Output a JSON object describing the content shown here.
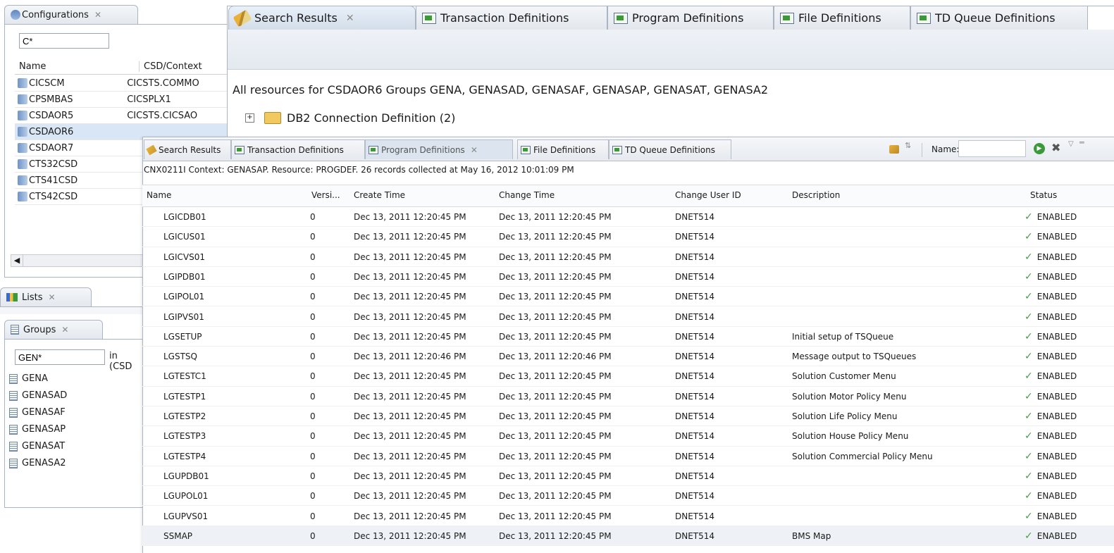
{
  "configurations": {
    "title": "Configurations",
    "filter": "C*",
    "columns": [
      "Name",
      "CSD/Context"
    ],
    "rows": [
      {
        "name": "CICSCM",
        "context": "CICSTS.COMMO"
      },
      {
        "name": "CPSMBAS",
        "context": "CICSPLX1"
      },
      {
        "name": "CSDAOR5",
        "context": "CICSTS.CICSAO"
      },
      {
        "name": "CSDAOR6",
        "context": ""
      },
      {
        "name": "CSDAOR7",
        "context": ""
      },
      {
        "name": "CTS32CSD",
        "context": ""
      },
      {
        "name": "CTS41CSD",
        "context": ""
      },
      {
        "name": "CTS42CSD",
        "context": ""
      }
    ]
  },
  "lists": {
    "title": "Lists"
  },
  "groups": {
    "title": "Groups",
    "filter": "GEN*",
    "in_label": "in (CSD",
    "items": [
      "GENA",
      "GENASAD",
      "GENASAF",
      "GENASAP",
      "GENASAT",
      "GENASA2"
    ]
  },
  "editor": {
    "tabs": [
      {
        "label": "Search Results"
      },
      {
        "label": "Transaction Definitions"
      },
      {
        "label": "Program Definitions"
      },
      {
        "label": "File Definitions"
      },
      {
        "label": "TD Queue Definitions"
      }
    ],
    "heading": "All resources for CSDAOR6 Groups GENA, GENASAD, GENASAF, GENASAP, GENASAT, GENASA2",
    "tree_item": "DB2 Connection Definition (2)"
  },
  "panel": {
    "tabs": [
      {
        "label": "Search Results"
      },
      {
        "label": "Transaction Definitions"
      },
      {
        "label": "Program Definitions"
      },
      {
        "label": "File Definitions"
      },
      {
        "label": "TD Queue Definitions"
      }
    ],
    "name_label": "Name:",
    "status_line": "CNX0211I Context: GENASAP. Resource: PROGDEF. 26 records collected at May 16, 2012 10:01:09 PM",
    "columns": [
      "Name",
      "Versi...",
      "Create Time",
      "Change Time",
      "Change User ID",
      "Description",
      "Status"
    ],
    "rows": [
      {
        "name": "LGICDB01",
        "ver": "0",
        "create": "Dec 13, 2011 12:20:45 PM",
        "change": "Dec 13, 2011 12:20:45 PM",
        "user": "DNET514",
        "desc": "",
        "status": "ENABLED"
      },
      {
        "name": "LGICUS01",
        "ver": "0",
        "create": "Dec 13, 2011 12:20:45 PM",
        "change": "Dec 13, 2011 12:20:45 PM",
        "user": "DNET514",
        "desc": "",
        "status": "ENABLED"
      },
      {
        "name": "LGICVS01",
        "ver": "0",
        "create": "Dec 13, 2011 12:20:45 PM",
        "change": "Dec 13, 2011 12:20:45 PM",
        "user": "DNET514",
        "desc": "",
        "status": "ENABLED"
      },
      {
        "name": "LGIPDB01",
        "ver": "0",
        "create": "Dec 13, 2011 12:20:45 PM",
        "change": "Dec 13, 2011 12:20:45 PM",
        "user": "DNET514",
        "desc": "",
        "status": "ENABLED"
      },
      {
        "name": "LGIPOL01",
        "ver": "0",
        "create": "Dec 13, 2011 12:20:45 PM",
        "change": "Dec 13, 2011 12:20:45 PM",
        "user": "DNET514",
        "desc": "",
        "status": "ENABLED"
      },
      {
        "name": "LGIPVS01",
        "ver": "0",
        "create": "Dec 13, 2011 12:20:45 PM",
        "change": "Dec 13, 2011 12:20:45 PM",
        "user": "DNET514",
        "desc": "",
        "status": "ENABLED"
      },
      {
        "name": "LGSETUP",
        "ver": "0",
        "create": "Dec 13, 2011 12:20:45 PM",
        "change": "Dec 13, 2011 12:20:45 PM",
        "user": "DNET514",
        "desc": "Initial setup of TSQueue",
        "status": "ENABLED"
      },
      {
        "name": "LGSTSQ",
        "ver": "0",
        "create": "Dec 13, 2011 12:20:46 PM",
        "change": "Dec 13, 2011 12:20:46 PM",
        "user": "DNET514",
        "desc": "Message output to TSQueues",
        "status": "ENABLED"
      },
      {
        "name": "LGTESTC1",
        "ver": "0",
        "create": "Dec 13, 2011 12:20:45 PM",
        "change": "Dec 13, 2011 12:20:45 PM",
        "user": "DNET514",
        "desc": "Solution Customer Menu",
        "status": "ENABLED"
      },
      {
        "name": "LGTESTP1",
        "ver": "0",
        "create": "Dec 13, 2011 12:20:45 PM",
        "change": "Dec 13, 2011 12:20:45 PM",
        "user": "DNET514",
        "desc": "Solution Motor Policy Menu",
        "status": "ENABLED"
      },
      {
        "name": "LGTESTP2",
        "ver": "0",
        "create": "Dec 13, 2011 12:20:45 PM",
        "change": "Dec 13, 2011 12:20:45 PM",
        "user": "DNET514",
        "desc": "Solution Life Policy Menu",
        "status": "ENABLED"
      },
      {
        "name": "LGTESTP3",
        "ver": "0",
        "create": "Dec 13, 2011 12:20:45 PM",
        "change": "Dec 13, 2011 12:20:45 PM",
        "user": "DNET514",
        "desc": "Solution House Policy Menu",
        "status": "ENABLED"
      },
      {
        "name": "LGTESTP4",
        "ver": "0",
        "create": "Dec 13, 2011 12:20:45 PM",
        "change": "Dec 13, 2011 12:20:45 PM",
        "user": "DNET514",
        "desc": "Solution Commercial Policy Menu",
        "status": "ENABLED"
      },
      {
        "name": "LGUPDB01",
        "ver": "0",
        "create": "Dec 13, 2011 12:20:45 PM",
        "change": "Dec 13, 2011 12:20:45 PM",
        "user": "DNET514",
        "desc": "",
        "status": "ENABLED"
      },
      {
        "name": "LGUPOL01",
        "ver": "0",
        "create": "Dec 13, 2011 12:20:45 PM",
        "change": "Dec 13, 2011 12:20:45 PM",
        "user": "DNET514",
        "desc": "",
        "status": "ENABLED"
      },
      {
        "name": "LGUPVS01",
        "ver": "0",
        "create": "Dec 13, 2011 12:20:45 PM",
        "change": "Dec 13, 2011 12:20:45 PM",
        "user": "DNET514",
        "desc": "",
        "status": "ENABLED"
      },
      {
        "name": "SSMAP",
        "ver": "0",
        "create": "Dec 13, 2011 12:20:45 PM",
        "change": "Dec 13, 2011 12:20:45 PM",
        "user": "DNET514",
        "desc": "BMS Map",
        "status": "ENABLED"
      }
    ]
  }
}
